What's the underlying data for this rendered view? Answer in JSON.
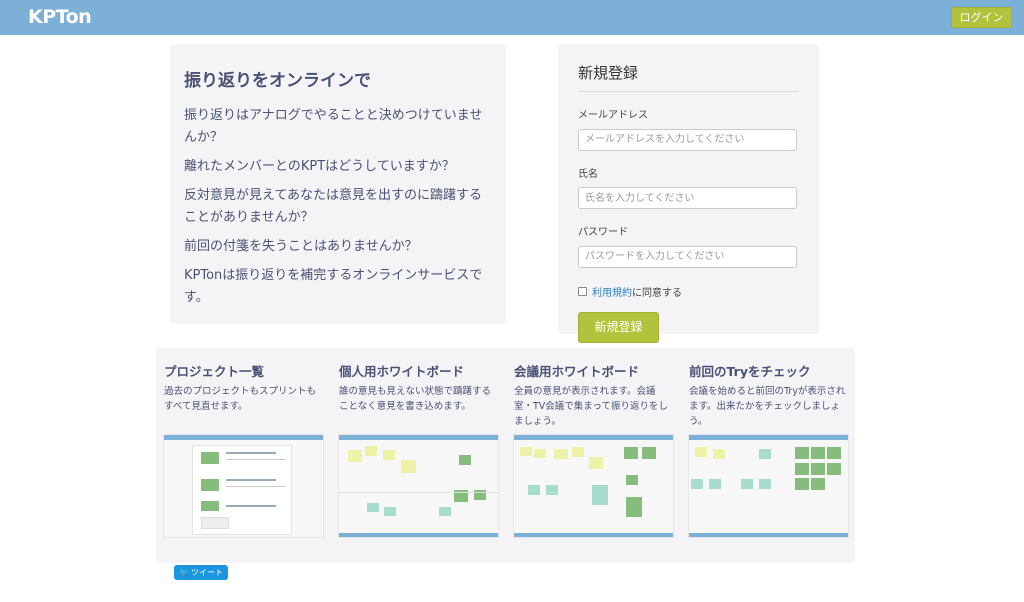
{
  "header": {
    "logo": "KPTon",
    "login_label": "ログイン"
  },
  "intro": {
    "title": "振り返りをオンラインで",
    "paragraphs": [
      "振り返りはアナログでやることと決めつけていませんか？",
      "離れたメンバーとのKPTはどうしていますか？",
      "反対意見が見えてあなたは意見を出すのに躊躇することがありませんか？",
      "前回の付箋を失うことはありませんか？",
      "KPTonは振り返りを補完するオンラインサービスです。"
    ]
  },
  "signup": {
    "title": "新規登録",
    "email_label": "メールアドレス",
    "email_placeholder": "メールアドレスを入力してください",
    "name_label": "氏名",
    "name_placeholder": "氏名を入力してください",
    "password_label": "パスワード",
    "password_placeholder": "パスワードを入力してください",
    "terms_link": "利用規約",
    "terms_suffix": "に同意する",
    "submit_label": "新規登録"
  },
  "features": [
    {
      "title": "プロジェクト一覧",
      "desc": "過去のプロジェクトもスプリントもすべて見直せます。"
    },
    {
      "title": "個人用ホワイトボード",
      "desc": "誰の意見も見えない状態で躊躇することなく意見を書き込めます。"
    },
    {
      "title": "会議用ホワイトボード",
      "desc": "全員の意見が表示されます。会議室・TV会議で集まって振り返りをしましょう。"
    },
    {
      "title": "前回のTryをチェック",
      "desc": "会議を始めると前回のTryが表示されます。出来たかをチェックしましょう。"
    }
  ],
  "tweet_label": "ツイート",
  "colors": {
    "header": "#7db0d6",
    "accent": "#b3c23c",
    "note_yellow": "#eef2a6",
    "note_green": "#86bd7c",
    "note_teal": "#a8dccf",
    "link": "#2b7fc2"
  }
}
